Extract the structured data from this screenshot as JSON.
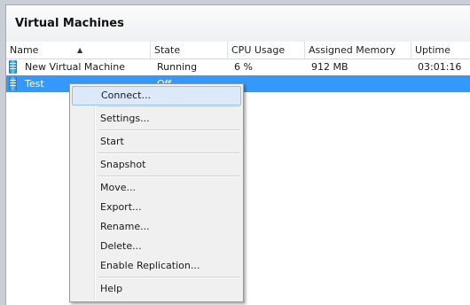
{
  "panel": {
    "title": "Virtual Machines"
  },
  "columns": [
    {
      "label": "Name"
    },
    {
      "label": "State"
    },
    {
      "label": "CPU Usage"
    },
    {
      "label": "Assigned Memory"
    },
    {
      "label": "Uptime"
    }
  ],
  "rows": [
    {
      "name": "New Virtual Machine",
      "state": "Running",
      "cpu": "6 %",
      "memory": "912 MB",
      "uptime": "03:01:16"
    },
    {
      "name": "Test",
      "state": "Off",
      "cpu": "",
      "memory": "",
      "uptime": ""
    }
  ],
  "context_menu": {
    "items": [
      {
        "label": "Connect..."
      },
      {
        "label": "Settings..."
      },
      {
        "label": "Start"
      },
      {
        "label": "Snapshot"
      },
      {
        "label": "Move..."
      },
      {
        "label": "Export..."
      },
      {
        "label": "Rename..."
      },
      {
        "label": "Delete..."
      },
      {
        "label": "Enable Replication..."
      },
      {
        "label": "Help"
      }
    ]
  },
  "colors": {
    "selection": "#3399ff",
    "menu_hover": "#dbe9f8"
  }
}
